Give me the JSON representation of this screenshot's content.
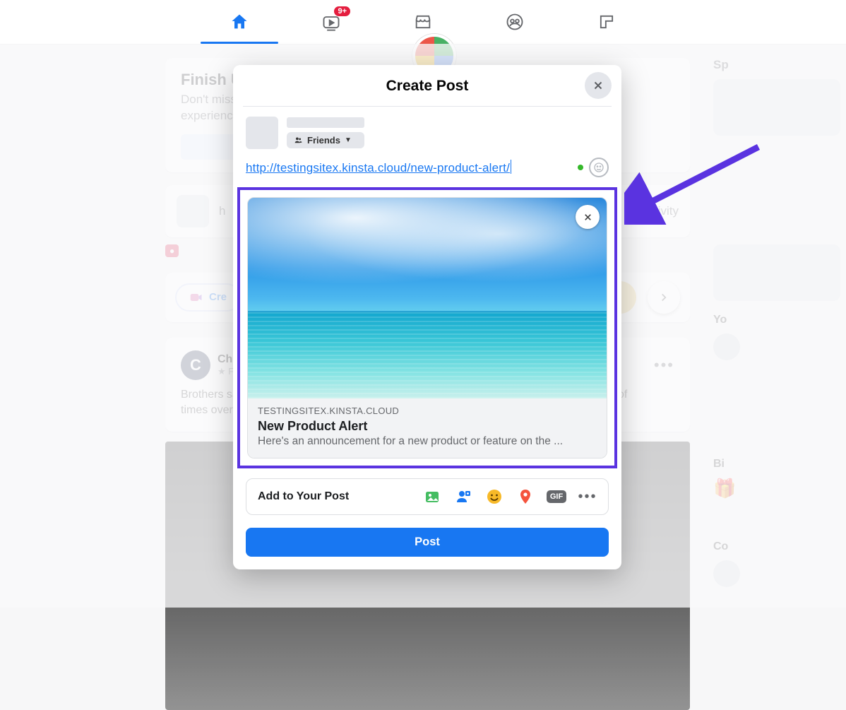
{
  "colors": {
    "accent": "#1877f2",
    "highlight": "#5a33e0",
    "badge": "#e41e3f"
  },
  "topnav": {
    "watch_badge": "9+"
  },
  "background": {
    "finish_title": "Finish U",
    "finish_sub_1": "Don't miss",
    "finish_sub_2": "experience",
    "activity_text": "ivity",
    "create_room": "Cre",
    "post_author": "Chi",
    "post_author_initial": "C",
    "post_sub": "F",
    "post_body_1": "Brothers sa",
    "post_body_2": "times over",
    "post_body_tail": "ozens of",
    "right": {
      "sponsored": "Sp",
      "your": "Yo",
      "birthdays": "Bi",
      "contacts": "Co"
    }
  },
  "modal": {
    "title": "Create Post",
    "friends_label": "Friends",
    "compose_url": "http://testingsitex.kinsta.cloud/new-product-alert/",
    "preview": {
      "domain": "TESTINGSITEX.KINSTA.CLOUD",
      "title": "New Product Alert",
      "description": "Here's an announcement for a new product or feature on the ..."
    },
    "add_to_post": "Add to Your Post",
    "gif_label": "GIF",
    "post_button": "Post"
  }
}
